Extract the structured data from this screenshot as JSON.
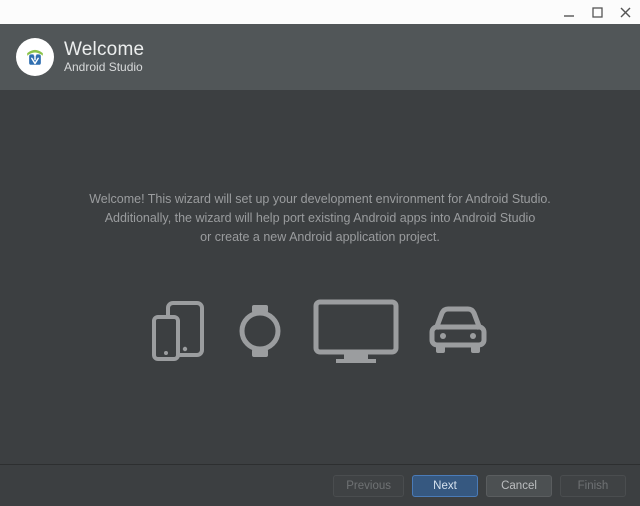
{
  "header": {
    "title": "Welcome",
    "subtitle": "Android Studio"
  },
  "content": {
    "line1": "Welcome! This wizard will set up your development environment for Android Studio.",
    "line2": "Additionally, the wizard will help port existing Android apps into Android Studio",
    "line3": "or create a new Android application project."
  },
  "footer": {
    "previous": "Previous",
    "next": "Next",
    "cancel": "Cancel",
    "finish": "Finish"
  }
}
